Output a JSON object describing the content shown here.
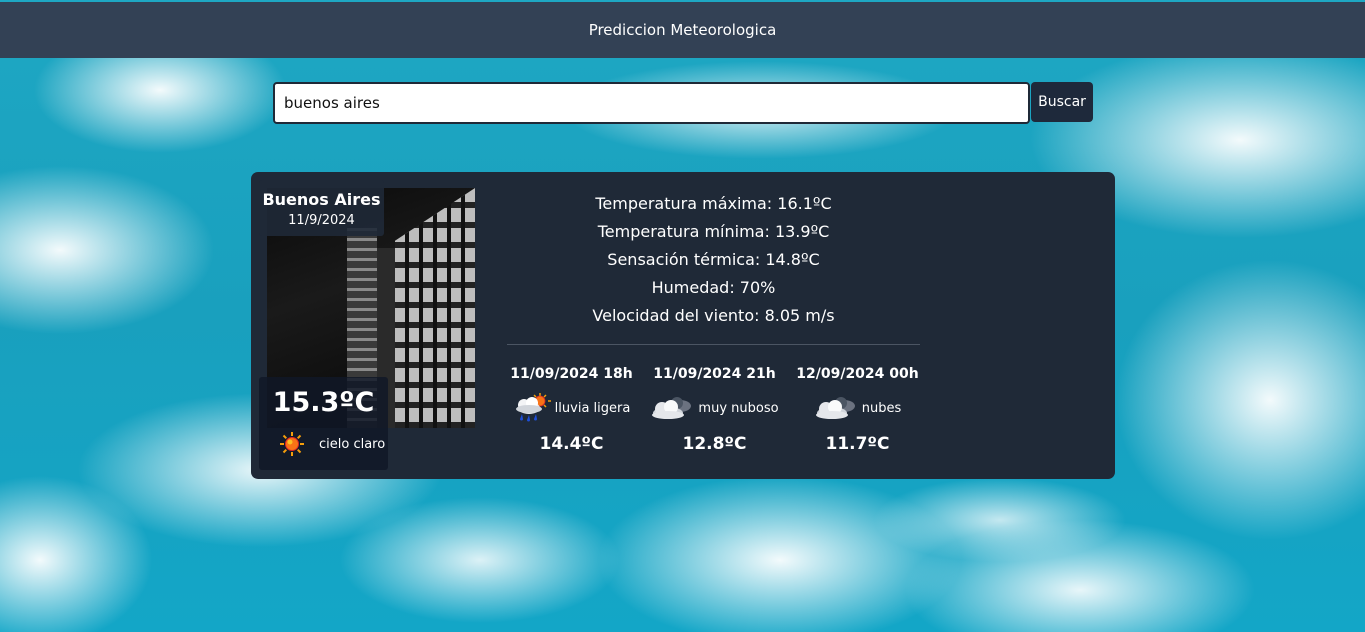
{
  "header": {
    "title": "Prediccion Meteorologica"
  },
  "search": {
    "value": "buenos aires",
    "button_label": "Buscar"
  },
  "city": {
    "name": "Buenos Aires",
    "date": "11/9/2024"
  },
  "current": {
    "temperature": "15.3ºC",
    "condition": "cielo claro",
    "icon": "sun-icon"
  },
  "stats": {
    "max": "Temperatura máxima: 16.1ºC",
    "min": "Temperatura mínima: 13.9ºC",
    "feels": "Sensación térmica: 14.8ºC",
    "humidity": "Humedad: 70%",
    "wind": "Velocidad del viento: 8.05 m/s"
  },
  "forecast": [
    {
      "time": "11/09/2024 18h",
      "condition": "lluvia ligera",
      "icon": "rain-sun-cloud-icon",
      "temperature": "14.4ºC"
    },
    {
      "time": "11/09/2024 21h",
      "condition": "muy nuboso",
      "icon": "cloud-icon",
      "temperature": "12.8ºC"
    },
    {
      "time": "12/09/2024 00h",
      "condition": "nubes",
      "icon": "cloud-icon",
      "temperature": "11.7ºC"
    }
  ],
  "colors": {
    "navbar": "#334155",
    "card": "#1f2937",
    "button": "#1e293b",
    "sky": "#19a0be"
  }
}
